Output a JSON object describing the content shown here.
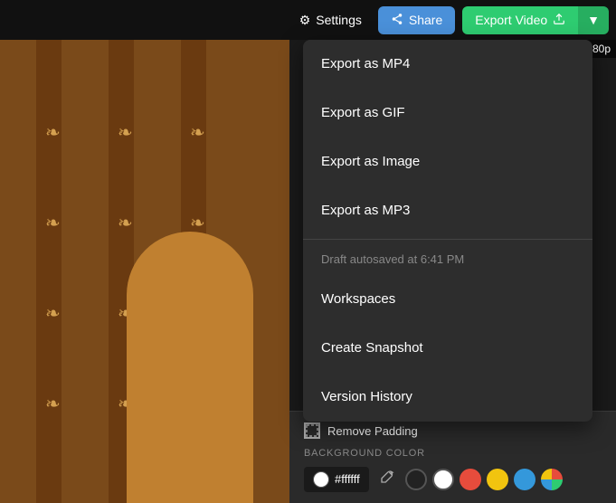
{
  "topbar": {
    "settings_label": "Settings",
    "share_label": "Share",
    "export_video_label": "Export Video",
    "resolution": "80p"
  },
  "dropdown": {
    "items": [
      {
        "id": "export-mp4",
        "label": "Export as MP4"
      },
      {
        "id": "export-gif",
        "label": "Export as GIF"
      },
      {
        "id": "export-image",
        "label": "Export as Image"
      },
      {
        "id": "export-mp3",
        "label": "Export as MP3"
      }
    ],
    "autosave_text": "Draft autosaved at 6:41 PM",
    "workspace_label": "Workspaces",
    "snapshot_label": "Create Snapshot",
    "version_history_label": "Version History"
  },
  "bottom_panel": {
    "remove_padding_label": "Remove Padding",
    "bg_color_section_label": "BACKGROUND COLOR",
    "color_hex": "#ffffff",
    "swatches": [
      "#222222",
      "#ffffff",
      "#e74c3c",
      "#f1c40f",
      "#3498db"
    ]
  }
}
